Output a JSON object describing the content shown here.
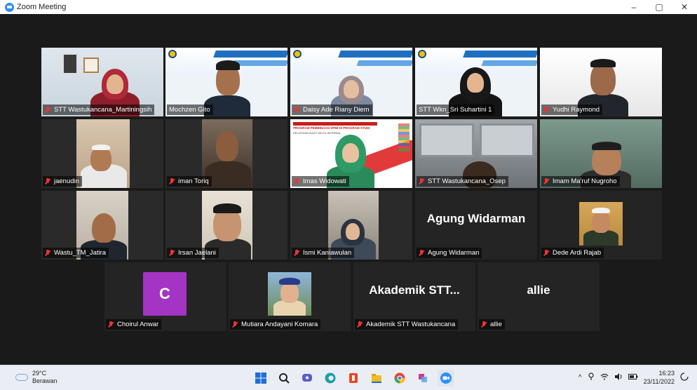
{
  "window": {
    "title": "Zoom Meeting",
    "controls": [
      "–",
      "▢",
      "✕"
    ]
  },
  "participants": [
    {
      "name": "STT Wastukancana_Martiningsih",
      "muted": true,
      "kind": "video"
    },
    {
      "name": "Mochzen Gito",
      "muted": false,
      "kind": "video",
      "active": true
    },
    {
      "name": "Daisy Ade Riany Diem",
      "muted": true,
      "kind": "video"
    },
    {
      "name": "STT Wkn_Sri Suhartini 1",
      "muted": false,
      "kind": "video"
    },
    {
      "name": "Yudhi Raymond",
      "muted": true,
      "kind": "video"
    },
    {
      "name": "jaenudin",
      "muted": true,
      "kind": "video"
    },
    {
      "name": "iman Toriq",
      "muted": true,
      "kind": "video"
    },
    {
      "name": "Imas Widowati",
      "muted": true,
      "kind": "video"
    },
    {
      "name": "STT Wastukancana_Osep",
      "muted": true,
      "kind": "video"
    },
    {
      "name": "Imam Ma'ruf Nugroho",
      "muted": true,
      "kind": "video"
    },
    {
      "name": "Wastu_TM_Jatira",
      "muted": true,
      "kind": "video"
    },
    {
      "name": "Irsan Jaelani",
      "muted": true,
      "kind": "video"
    },
    {
      "name": "Ismi Kaniawulan",
      "muted": true,
      "kind": "video"
    },
    {
      "name": "Agung Widarman",
      "muted": true,
      "kind": "name",
      "display": "Agung Widarman"
    },
    {
      "name": "Dede Ardi Rajab",
      "muted": true,
      "kind": "photo"
    },
    {
      "name": "Choirul Anwar",
      "muted": true,
      "kind": "initial",
      "initial": "C"
    },
    {
      "name": "Mutiara Andayani Komara",
      "muted": true,
      "kind": "photo"
    },
    {
      "name": "Akademik STT Wastukancana",
      "muted": true,
      "kind": "name",
      "display": "Akademik  STT..."
    },
    {
      "name": "allie",
      "muted": true,
      "kind": "name",
      "display": "allie"
    }
  ],
  "slide": {
    "line1": "PROGRAM PEMBINAAN SPMI DI PROGRAM STUDI",
    "line2": "PELATIHAN AUDIT MUTU INTERNAL"
  },
  "taskbar": {
    "weather_temp": "29°C",
    "weather_desc": "Berawan",
    "time": "16:23",
    "date": "23/11/2022",
    "tray_up": "^"
  },
  "colors": {
    "active_border": "#c9e338",
    "initial_avatar": "#a434c4",
    "zoom_blue": "#2d8cff"
  }
}
